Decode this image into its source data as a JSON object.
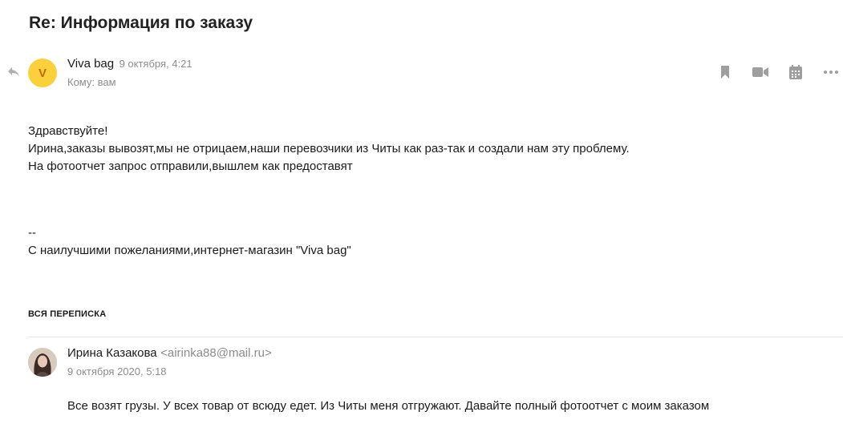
{
  "message": {
    "subject": "Re: Информация по заказу",
    "sender": {
      "avatar_letter": "V",
      "name": "Viva bag",
      "date": "9 октября, 4:21",
      "to": "Кому: вам"
    },
    "toolbar": [
      "bookmark-icon",
      "video-icon",
      "calendar-icon",
      "more-icon"
    ],
    "body": [
      "Здравствуйте!",
      "Ирина,заказы вывозят,мы не отрицаем,наши перевозчики из Читы как раз-так и создали нам эту проблему.",
      "На фотоотчет запрос отправили,вышлем как предоставят"
    ],
    "signature": {
      "separator": "--",
      "text": "С наилучшими пожеланиями,интернет-магазин \"Viva bag\""
    }
  },
  "thread": {
    "label": "ВСЯ ПЕРЕПИСКА",
    "items": [
      {
        "name": "Ирина Казакова",
        "email": "<airinka88@mail.ru>",
        "date": "9 октября 2020, 5:18",
        "body": "Все возят грузы. У всех товар от всюду едет. Из Читы меня отгружают. Давайте полный фотоотчет с моим заказом"
      }
    ]
  },
  "colors": {
    "avatar_bg": "#fbd03d",
    "avatar_letter": "#c06a00",
    "icon_gray": "#9e9e9e",
    "meta_gray": "#8c8c8c"
  }
}
